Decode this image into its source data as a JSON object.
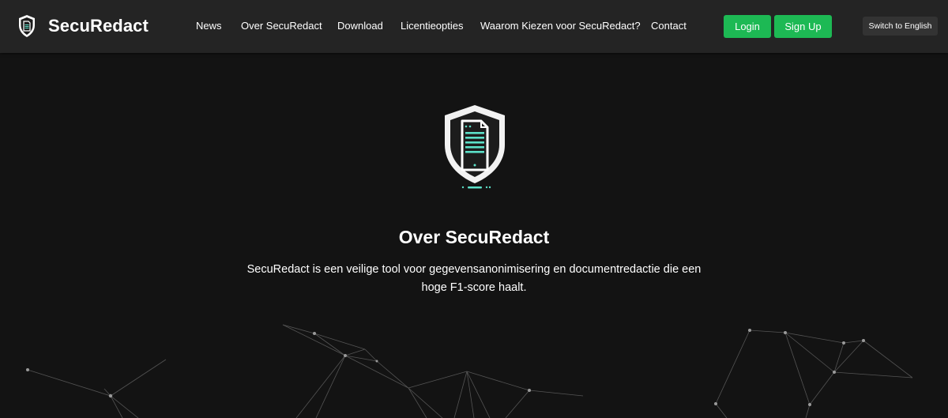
{
  "brand": {
    "name": "SecuRedact",
    "icon": "shield-document-icon"
  },
  "nav": {
    "links": [
      "News",
      "Over SecuRedact",
      "Download",
      "Licentieopties",
      "Waarom Kiezen voor SecuRedact?",
      "Contact"
    ],
    "login_label": "Login",
    "signup_label": "Sign Up",
    "language_label": "Switch to English"
  },
  "hero": {
    "icon": "shield-document-icon",
    "title": "Over SecuRedact",
    "text": "SecuRedact is een veilige tool voor gegevensanonimisering en documentredactie die een hoge F1-score haalt."
  },
  "colors": {
    "background": "#131313",
    "navbar": "#242424",
    "accent_green": "#1db954",
    "accent_teal": "#5ce0c8",
    "language_button": "#333333",
    "network_lines": "#6a6a6a"
  }
}
